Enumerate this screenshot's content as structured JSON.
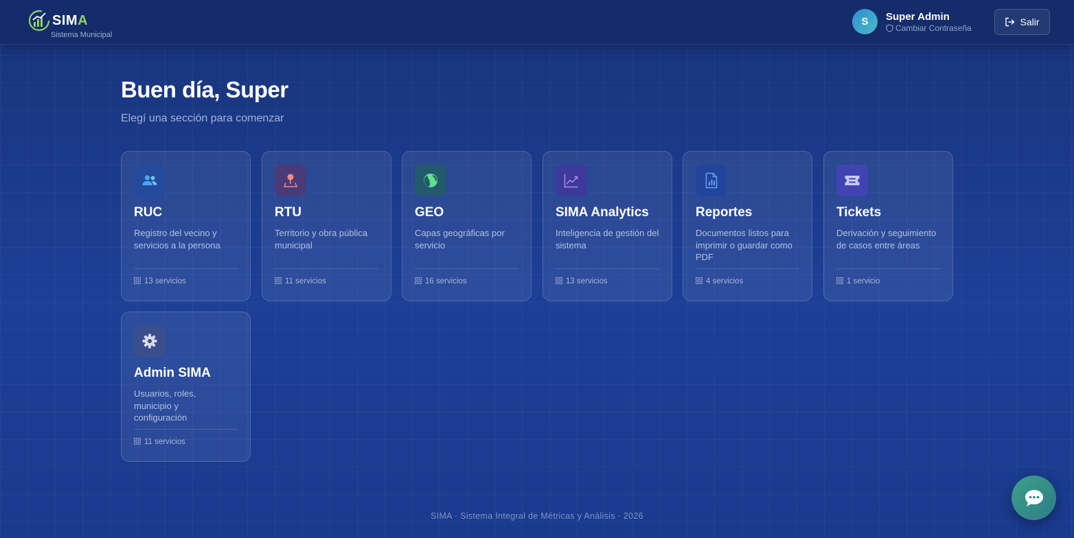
{
  "header": {
    "logo_text_prefix": "SIM",
    "logo_text_accent": "A",
    "logo_subtitle": "Sistema Municipal",
    "user_initial": "S",
    "user_name": "Super Admin",
    "change_password_label": "Cambiar Contraseña",
    "logout_label": "Salir"
  },
  "main": {
    "greeting": "Buen día, Super",
    "subtitle": "Elegí una sección para comenzar"
  },
  "cards": [
    {
      "title": "RUC",
      "description": "Registro del vecino y servicios a la persona",
      "count": "13 servicios",
      "icon": "users-icon",
      "icon_color": "#4aa8f0",
      "icon_bg": "#244a9b"
    },
    {
      "title": "RTU",
      "description": "Territorio y obra pública municipal",
      "count": "11 servicios",
      "icon": "map-pin-icon",
      "icon_color": "#f08a8a",
      "icon_bg": "#4a3b78"
    },
    {
      "title": "GEO",
      "description": "Capas geográficas por servicio",
      "count": "16 servicios",
      "icon": "globe-icon",
      "icon_color": "#5ee08f",
      "icon_bg": "#235a6b"
    },
    {
      "title": "SIMA Analytics",
      "description": "Inteligencia de gestión del sistema",
      "count": "13 servicios",
      "icon": "chart-line-icon",
      "icon_color": "#b18af5",
      "icon_bg": "#3b3a9a"
    },
    {
      "title": "Reportes",
      "description": "Documentos listos para imprimir o guardar como PDF",
      "count": "4 servicios",
      "icon": "document-chart-icon",
      "icon_color": "#6a9cf5",
      "icon_bg": "#21459a"
    },
    {
      "title": "Tickets",
      "description": "Derivación y seguimiento de casos entre áreas",
      "count": "1 servicio",
      "icon": "ticket-icon",
      "icon_color": "#c5c9ff",
      "icon_bg": "#4243b3"
    },
    {
      "title": "Admin SIMA",
      "description": "Usuarios, roles, municipio y configuración",
      "count": "11 servicios",
      "icon": "gear-icon",
      "icon_color": "#d6dcec",
      "icon_bg": "#3a4d8c"
    }
  ],
  "footer": {
    "text": "SIMA · Sistema Integral de Métricas y Análisis  ·  2026"
  },
  "chat": {
    "icon": "chat-bubble-icon"
  }
}
